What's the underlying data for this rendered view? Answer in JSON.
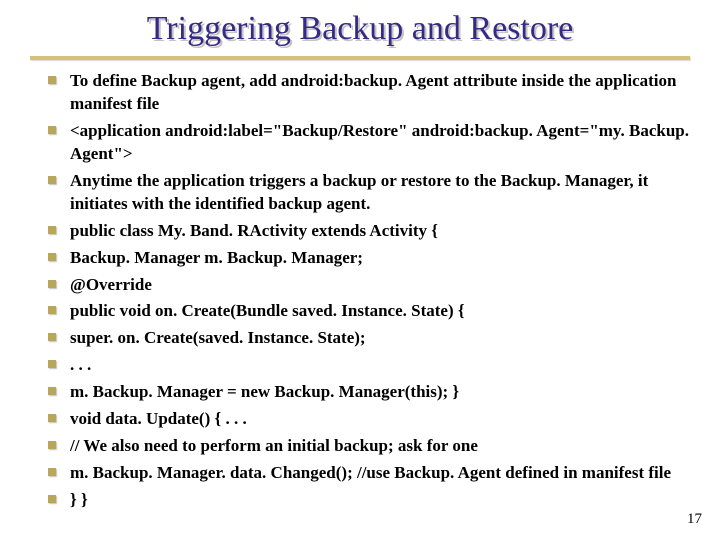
{
  "title": "Triggering Backup and Restore",
  "bullets": [
    "To define Backup agent, add  android:backup. Agent  attribute inside the application manifest file",
    "  <application android:label=\"Backup/Restore\" android:backup. Agent=\"my. Backup. Agent\">",
    "Anytime the application triggers a backup or restore to the Backup. Manager, it initiates with the identified backup agent.",
    "   public class My. Band. RActivity extends Activity {",
    "       Backup. Manager m. Backup. Manager;",
    "        @Override",
    "       public void on. Create(Bundle saved. Instance. State) {",
    "   super. on. Create(saved. Instance. State);",
    "   . . .",
    "   m. Backup. Manager = new Backup. Manager(this);      }",
    "       void data. Update() {  . . .",
    "   // We also need to perform an initial backup; ask for one",
    "   m. Backup. Manager. data. Changed(); //use Backup. Agent defined in manifest file",
    "       }    }"
  ],
  "page_number": "17"
}
